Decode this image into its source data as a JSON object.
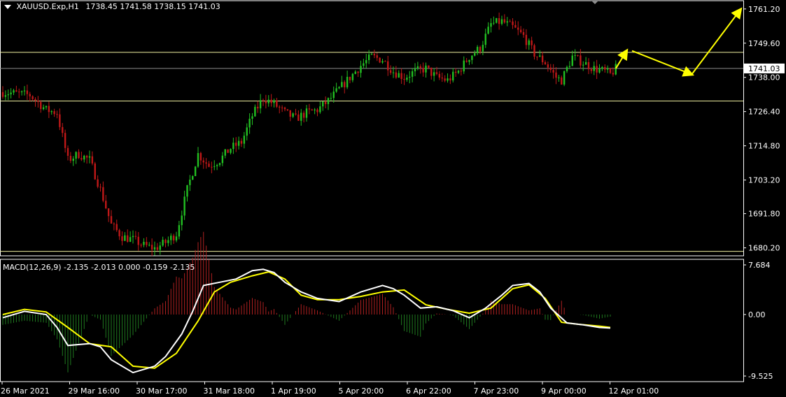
{
  "header": {
    "symbol": "XAUUSD.Exp,H1",
    "ohlc": "1738.45 1741.58 1738.15 1741.03"
  },
  "macd_header": "MACD(12,26,9) -2.135 -2.013 0.000 -0.159 -2.135",
  "price_axis": {
    "ticks": [
      "1761.20",
      "1749.60",
      "1738.00",
      "1726.40",
      "1714.80",
      "1703.20",
      "1691.80",
      "1680.20"
    ],
    "current_price": "1741.03"
  },
  "macd_axis": {
    "ticks": [
      "7.684",
      "0.00",
      "-9.525"
    ]
  },
  "time_axis": {
    "labels": [
      "26 Mar 2021",
      "29 Mar 16:00",
      "30 Mar 17:00",
      "31 Mar 18:00",
      "1 Apr 19:00",
      "5 Apr 20:00",
      "6 Apr 22:00",
      "7 Apr 23:00",
      "9 Apr 00:00",
      "12 Apr 01:00"
    ]
  },
  "colors": {
    "background": "#000000",
    "bull": "#22c022",
    "bear": "#c01818",
    "level_line": "#f0f0a0",
    "current_price_line": "#8a8a8a",
    "arrow": "#ffff00",
    "macd_main": "#ffffff",
    "macd_signal": "#ffff00",
    "hist_positive": "#b02020",
    "hist_negative": "#1f7a1f"
  },
  "chart_data": [
    {
      "type": "candlestick",
      "symbol": "XAUUSD.Exp",
      "timeframe": "H1",
      "ylim": [
        1677.5,
        1764.0
      ],
      "close_path": [
        [
          0,
          1733
        ],
        [
          5,
          1732
        ],
        [
          8,
          1727
        ],
        [
          10,
          1726
        ],
        [
          12,
          1710
        ],
        [
          14,
          1712
        ],
        [
          16,
          1710
        ],
        [
          18,
          1700
        ],
        [
          20,
          1688
        ],
        [
          22,
          1684
        ],
        [
          24,
          1683
        ],
        [
          26,
          1681
        ],
        [
          28,
          1680
        ],
        [
          30,
          1682
        ],
        [
          32,
          1685
        ],
        [
          34,
          1700
        ],
        [
          36,
          1712
        ],
        [
          38,
          1708
        ],
        [
          40,
          1710
        ],
        [
          42,
          1714
        ],
        [
          44,
          1716
        ],
        [
          46,
          1725
        ],
        [
          48,
          1731
        ],
        [
          50,
          1729
        ],
        [
          52,
          1726
        ],
        [
          54,
          1724
        ],
        [
          56,
          1726
        ],
        [
          58,
          1727
        ],
        [
          60,
          1730
        ],
        [
          62,
          1734
        ],
        [
          64,
          1738
        ],
        [
          66,
          1742
        ],
        [
          68,
          1745
        ],
        [
          70,
          1744
        ],
        [
          72,
          1740
        ],
        [
          74,
          1738
        ],
        [
          76,
          1740
        ],
        [
          78,
          1741
        ],
        [
          80,
          1738
        ],
        [
          82,
          1737
        ],
        [
          84,
          1740
        ],
        [
          86,
          1745
        ],
        [
          88,
          1748
        ],
        [
          90,
          1756
        ],
        [
          92,
          1757
        ],
        [
          94,
          1755
        ],
        [
          96,
          1752
        ],
        [
          98,
          1746
        ],
        [
          100,
          1743
        ],
        [
          102,
          1738
        ],
        [
          103,
          1737
        ],
        [
          105,
          1745
        ],
        [
          107,
          1743
        ],
        [
          109,
          1741
        ],
        [
          111,
          1740
        ],
        [
          112,
          1739
        ],
        [
          113,
          1741
        ]
      ],
      "key_levels": [
        1746.5,
        1730.0,
        1679.0
      ],
      "current_price": 1741.03,
      "projection_arrows": [
        [
          [
            113,
            1741
          ],
          [
            115,
            1747
          ]
        ],
        [
          [
            116,
            1747
          ],
          [
            127,
            1739
          ]
        ],
        [
          [
            127,
            1739
          ],
          [
            136,
            1761
          ]
        ]
      ]
    },
    {
      "type": "macd",
      "params": [
        12,
        26,
        9
      ],
      "ylim": [
        -9.525,
        7.684
      ],
      "main_path": [
        [
          0,
          -0.5
        ],
        [
          4,
          0.5
        ],
        [
          8,
          0.0
        ],
        [
          10,
          -2.0
        ],
        [
          12,
          -4.8
        ],
        [
          16,
          -4.5
        ],
        [
          18,
          -5.0
        ],
        [
          20,
          -7.0
        ],
        [
          24,
          -9.0
        ],
        [
          28,
          -8.0
        ],
        [
          30,
          -6.5
        ],
        [
          33,
          -3.0
        ],
        [
          35,
          0.5
        ],
        [
          37,
          4.5
        ],
        [
          40,
          5.0
        ],
        [
          43,
          5.5
        ],
        [
          46,
          6.8
        ],
        [
          48,
          7.0
        ],
        [
          50,
          6.5
        ],
        [
          52,
          5.0
        ],
        [
          55,
          3.5
        ],
        [
          58,
          2.5
        ],
        [
          62,
          2.0
        ],
        [
          66,
          3.5
        ],
        [
          70,
          4.5
        ],
        [
          72,
          4.0
        ],
        [
          74,
          3.0
        ],
        [
          77,
          1.0
        ],
        [
          80,
          1.2
        ],
        [
          83,
          0.6
        ],
        [
          86,
          -0.5
        ],
        [
          89,
          1.0
        ],
        [
          92,
          3.0
        ],
        [
          94,
          4.5
        ],
        [
          97,
          4.8
        ],
        [
          99,
          3.5
        ],
        [
          101,
          1.0
        ],
        [
          104,
          -1.3
        ],
        [
          107,
          -1.6
        ],
        [
          110,
          -2.0
        ],
        [
          112,
          -2.1
        ]
      ],
      "signal_path": [
        [
          0,
          0.0
        ],
        [
          4,
          0.8
        ],
        [
          8,
          0.4
        ],
        [
          12,
          -2.0
        ],
        [
          16,
          -4.5
        ],
        [
          20,
          -5.0
        ],
        [
          24,
          -8.0
        ],
        [
          28,
          -8.3
        ],
        [
          32,
          -6.0
        ],
        [
          36,
          -1.0
        ],
        [
          39,
          3.5
        ],
        [
          42,
          5.0
        ],
        [
          46,
          6.0
        ],
        [
          49,
          6.6
        ],
        [
          52,
          5.5
        ],
        [
          55,
          3.0
        ],
        [
          58,
          2.3
        ],
        [
          62,
          2.3
        ],
        [
          66,
          2.8
        ],
        [
          70,
          3.5
        ],
        [
          74,
          3.8
        ],
        [
          78,
          1.5
        ],
        [
          82,
          0.8
        ],
        [
          86,
          0.2
        ],
        [
          90,
          1.0
        ],
        [
          94,
          4.0
        ],
        [
          97,
          4.6
        ],
        [
          100,
          2.5
        ],
        [
          103,
          -1.2
        ],
        [
          106,
          -1.5
        ],
        [
          110,
          -1.8
        ],
        [
          112,
          -2.0
        ]
      ]
    }
  ]
}
